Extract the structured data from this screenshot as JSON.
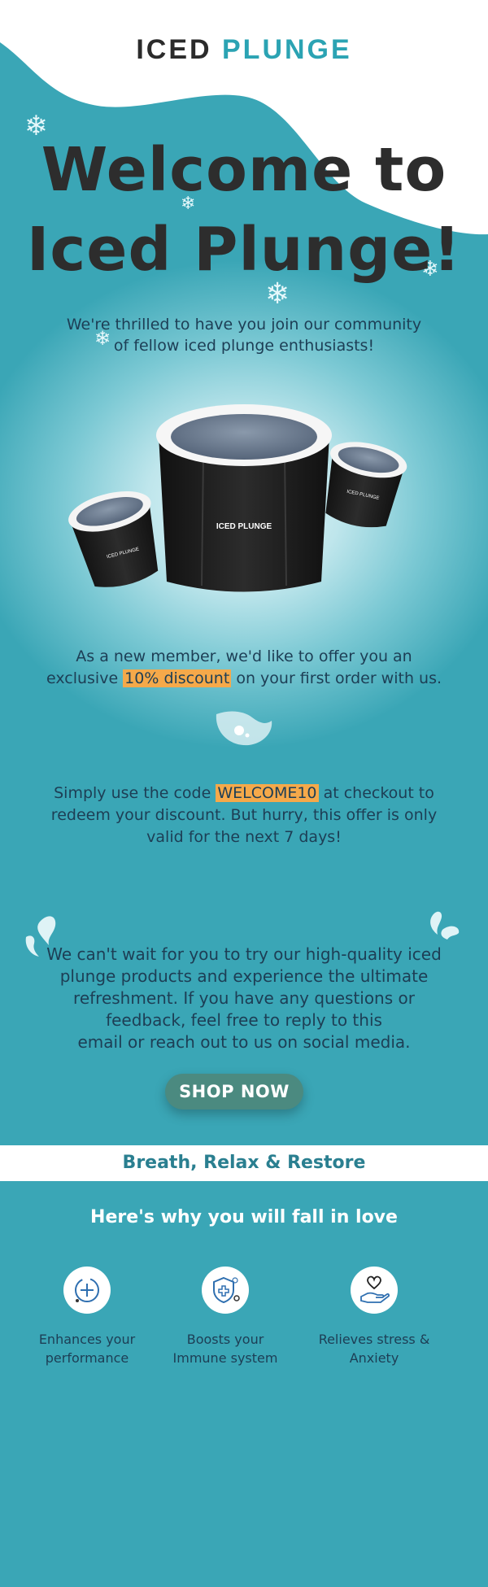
{
  "logo": {
    "part1": "IC",
    "part2": "ED",
    "part3": "PLUNGE"
  },
  "header": {
    "title_line1": "Welcome to",
    "title_line2": "Iced Plunge!"
  },
  "intro": {
    "line1": "We're thrilled to have you join our community",
    "line2": "of fellow iced plunge enthusiasts!"
  },
  "product": {
    "brand_label": "ICED PLUNGE"
  },
  "offer": {
    "line1": "As a new member, we'd like to offer you an",
    "line2_before": "exclusive ",
    "discount": "10% discount",
    "line2_after": " on your first order with us."
  },
  "code": {
    "before": "Simply use the code ",
    "value": "WELCOME10",
    "after": " at checkout to",
    "line2": "redeem your discount. But hurry, this offer is only",
    "line3": "valid for the next 7 days!"
  },
  "closing": {
    "line1": "We can't wait for you to try our high-quality iced",
    "line2": "plunge products and experience the ultimate",
    "line3": "refreshment. If you have any questions or",
    "line4": "feedback, feel free to reply to this",
    "line5": "email or reach out to us on social media."
  },
  "cta": {
    "label": "SHOP NOW"
  },
  "tagline": "Breath, Relax & Restore",
  "features_heading": "Here's why you will fall in love",
  "features": [
    {
      "icon": "performance-icon",
      "line1": "Enhances your",
      "line2": "performance"
    },
    {
      "icon": "immune-shield-icon",
      "line1": "Boosts your",
      "line2": "Immune system"
    },
    {
      "icon": "heart-hand-icon",
      "line1": "Relieves stress &",
      "line2": "Anxiety"
    }
  ],
  "colors": {
    "background": "#3aa6b6",
    "highlight": "#f5a94a",
    "button": "#4b8a80",
    "accent": "#2ba3b3"
  }
}
